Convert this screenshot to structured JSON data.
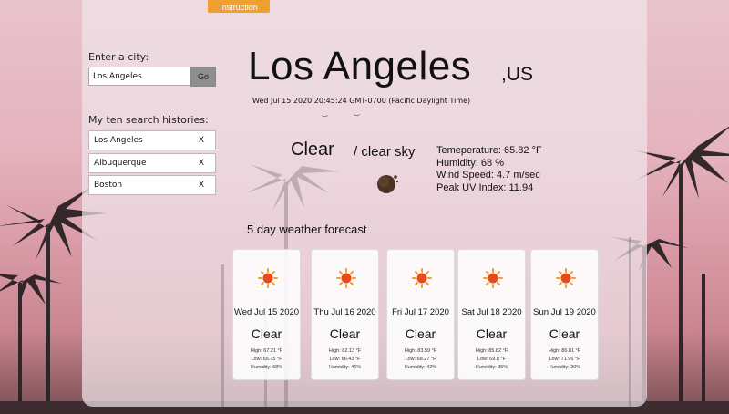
{
  "toolbar": {
    "instruction_label": "Instruction"
  },
  "search": {
    "label": "Enter a city:",
    "value": "Los Angeles",
    "go_label": "Go"
  },
  "history": {
    "label": "My ten search histories:",
    "items": [
      {
        "name": "Los Angeles",
        "remove": "X"
      },
      {
        "name": "Albuquerque",
        "remove": "X"
      },
      {
        "name": "Boston",
        "remove": "X"
      }
    ]
  },
  "current": {
    "city": "Los Angeles",
    "country": ",US",
    "datetime": "Wed Jul 15 2020 20:45:24 GMT-0700 (Pacific Daylight Time)",
    "condition": "Clear",
    "description": "/ clear sky",
    "icon": "clear-night-moon-icon",
    "temperature": "Temeperature: 65.82 °F",
    "humidity": "Humidity: 68 %",
    "wind": "Wind Speed: 4.7 m/sec",
    "uv": "Peak UV Index: 11.94"
  },
  "forecast": {
    "title": "5 day weather forecast",
    "days": [
      {
        "date": "Wed Jul 15 2020",
        "condition": "Clear",
        "high": "High: 67.21 °F",
        "low": "Low: 65.75 °F",
        "humidity": "Humidity: 68%"
      },
      {
        "date": "Thu Jul 16 2020",
        "condition": "Clear",
        "high": "High: 82.13 °F",
        "low": "Low: 66.43 °F",
        "humidity": "Humidity: 46%"
      },
      {
        "date": "Fri Jul 17 2020",
        "condition": "Clear",
        "high": "High: 83.59 °F",
        "low": "Low: 68.27 °F",
        "humidity": "Humidity: 42%"
      },
      {
        "date": "Sat Jul 18 2020",
        "condition": "Clear",
        "high": "High: 85.82 °F",
        "low": "Low: 69.8 °F",
        "humidity": "Humidity: 35%"
      },
      {
        "date": "Sun Jul 19 2020",
        "condition": "Clear",
        "high": "High: 86.81 °F",
        "low": "Low: 71.96 °F",
        "humidity": "Humidity: 30%"
      }
    ]
  },
  "colors": {
    "accent": "#f0a030",
    "sun": "#e84a1a",
    "sun_rays": "#f0a030"
  }
}
